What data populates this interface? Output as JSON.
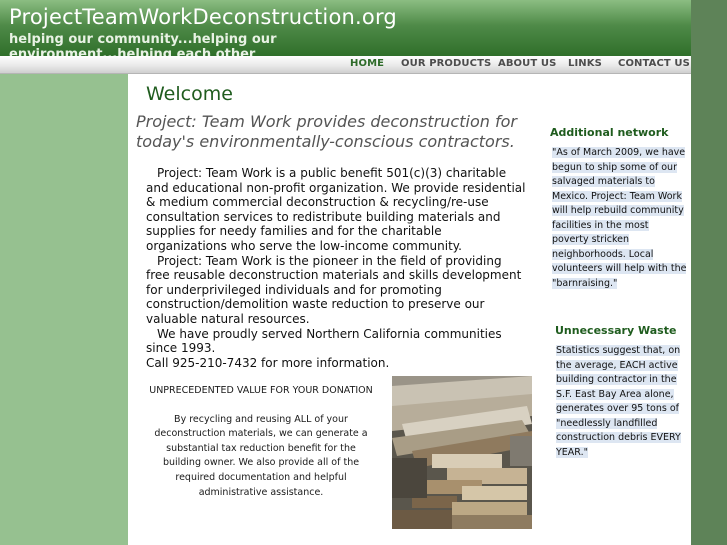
{
  "header": {
    "site_title": "ProjectTeamWorkDeconstruction.org",
    "tagline": "helping our community...helping our environment...helping each other"
  },
  "nav": {
    "items": [
      {
        "label": "HOME",
        "active": true
      },
      {
        "label": "OUR PRODUCTS",
        "active": false
      },
      {
        "label": "ABOUT US",
        "active": false
      },
      {
        "label": "LINKS",
        "active": false
      },
      {
        "label": "CONTACT US",
        "active": false
      }
    ]
  },
  "main": {
    "welcome": "Welcome",
    "lead": "Project: Team Work provides deconstruction for today's environmentally-conscious contractors.",
    "paragraphs": [
      "Project: Team Work is a public benefit 501(c)(3) charitable and educational non-profit organization. We provide residential & medium commercial deconstruction & recycling/re-use consultation services to redistribute building materials and supplies for needy families and for the charitable organizations who serve the low-income community.",
      "Project: Team Work is the pioneer in the field of providing free reusable deconstruction materials and skills development for underprivileged individuals and for promoting construction/demolition waste reduction to preserve our valuable natural resources.",
      "We have proudly served Northern California communities since 1993.",
      "Call 925-210-7432 for more information."
    ],
    "promo_heading": "UNPRECEDENTED VALUE FOR YOUR DONATION",
    "promo_text": "By recycling and reusing ALL of your deconstruction materials, we can generate a substantial tax reduction benefit for the building owner. We also provide all of the required documentation and helpful administrative assistance."
  },
  "sidebar": {
    "section1_title": "Additional network",
    "section1_text": "\"As of March 2009, we have begun to ship some of our salvaged materials to Mexico.  Project: Team Work will help rebuild community facilities in the most poverty stricken neighborhoods. Local volunteers will help with the \"barnraising.\"",
    "section2_title": "Unnecessary Waste",
    "section2_text": "Statistics suggest that, on the average, EACH active building contractor in the S.F. East Bay Area alone, generates over 95 tons of \"needlessly landfilled construction debris EVERY YEAR.\""
  },
  "colors": {
    "brand_green": "#1f5c1e",
    "header_green": "#4f8a48",
    "left_strip": "#96c190",
    "right_strip": "#5e8358"
  }
}
